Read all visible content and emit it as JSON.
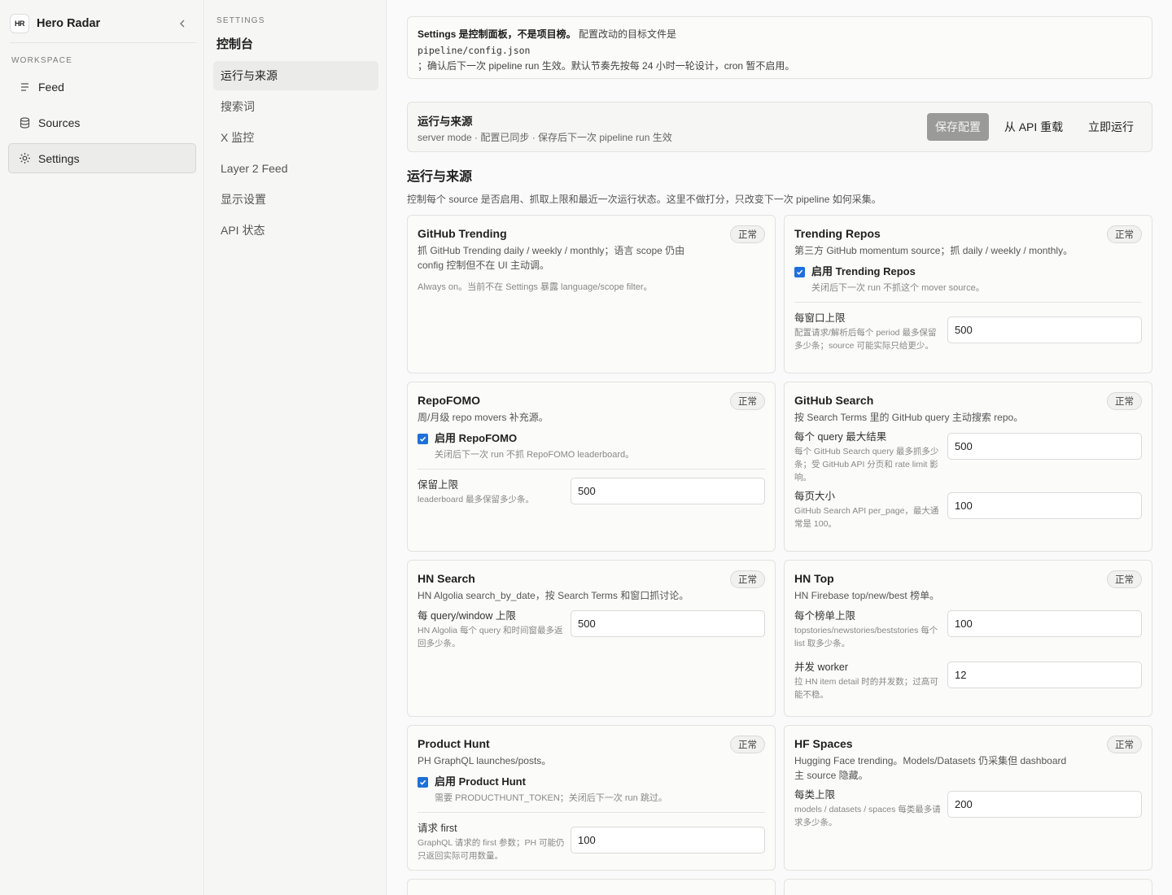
{
  "sidebar": {
    "logo_text": "HR",
    "app_name": "Hero Radar",
    "workspace_label": "WORKSPACE",
    "items": [
      {
        "label": "Feed",
        "icon": "list-icon"
      },
      {
        "label": "Sources",
        "icon": "database-icon"
      },
      {
        "label": "Settings",
        "icon": "gear-icon",
        "active": true
      }
    ]
  },
  "subnav": {
    "kicker": "SETTINGS",
    "title": "控制台",
    "items": [
      {
        "label": "运行与来源",
        "active": true
      },
      {
        "label": "搜索词"
      },
      {
        "label": "X 监控"
      },
      {
        "label": "Layer 2 Feed"
      },
      {
        "label": "显示设置"
      },
      {
        "label": "API 状态"
      }
    ]
  },
  "notice": {
    "bold": "Settings 是控制面板，不是项目榜。",
    "text": "配置改动的目标文件是",
    "path": "pipeline/config.json",
    "line3": "；确认后下一次 pipeline run 生效。默认节奏先按每 24 小时一轮设计，cron 暂不启用。"
  },
  "run_bar": {
    "title": "运行与来源",
    "subtitle": "server mode · 配置已同步 · 保存后下一次 pipeline run 生效",
    "save_label": "保存配置",
    "reload_label": "从 API 重载",
    "run_label": "立即运行"
  },
  "section": {
    "title": "运行与来源",
    "desc": "控制每个 source 是否启用、抓取上限和最近一次运行状态。这里不做打分，只改变下一次 pipeline 如何采集。"
  },
  "cards": [
    {
      "title": "GitHub Trending",
      "status": "正常",
      "desc": "抓 GitHub Trending daily / weekly / monthly；语言 scope 仍由 config 控制但不在 UI 主动调。",
      "note": "Always on。当前不在 Settings 暴露 language/scope filter。"
    },
    {
      "title": "Trending Repos",
      "status": "正常",
      "desc": "第三方 GitHub momentum source；抓 daily / weekly / monthly。",
      "toggle_label": "启用 Trending Repos",
      "toggle_help": "关闭后下一次 run 不抓这个 mover source。",
      "fields": [
        {
          "label": "每窗口上限",
          "help": "配置请求/解析后每个 period 最多保留多少条；source 可能实际只给更少。",
          "value": "500"
        }
      ]
    },
    {
      "title": "RepoFOMO",
      "status": "正常",
      "desc": "周/月级 repo movers 补充源。",
      "toggle_label": "启用 RepoFOMO",
      "toggle_help": "关闭后下一次 run 不抓 RepoFOMO leaderboard。",
      "fields": [
        {
          "label": "保留上限",
          "help": "leaderboard 最多保留多少条。",
          "value": "500"
        }
      ]
    },
    {
      "title": "GitHub Search",
      "status": "正常",
      "desc": "按 Search Terms 里的 GitHub query 主动搜索 repo。",
      "fields": [
        {
          "label": "每个 query 最大结果",
          "help": "每个 GitHub Search query 最多抓多少条；受 GitHub API 分页和 rate limit 影响。",
          "value": "500"
        },
        {
          "label": "每页大小",
          "help": "GitHub Search API per_page，最大通常是 100。",
          "value": "100"
        }
      ]
    },
    {
      "title": "HN Search",
      "status": "正常",
      "desc": "HN Algolia search_by_date，按 Search Terms 和窗口抓讨论。",
      "fields": [
        {
          "label": "每 query/window 上限",
          "help": "HN Algolia 每个 query 和时间窗最多返回多少条。",
          "value": "500"
        }
      ]
    },
    {
      "title": "HN Top",
      "status": "正常",
      "desc": "HN Firebase top/new/best 榜单。",
      "fields": [
        {
          "label": "每个榜单上限",
          "help": "topstories/newstories/beststories 每个 list 取多少条。",
          "value": "100"
        },
        {
          "label": "并发 worker",
          "help": "拉 HN item detail 时的并发数；过高可能不稳。",
          "value": "12"
        }
      ]
    },
    {
      "title": "Product Hunt",
      "status": "正常",
      "desc": "PH GraphQL launches/posts。",
      "toggle_label": "启用 Product Hunt",
      "toggle_help": "需要 PRODUCTHUNT_TOKEN；关闭后下一次 run 跳过。",
      "fields": [
        {
          "label": "请求 first",
          "help": "GraphQL 请求的 first 参数；PH 可能仍只返回实际可用数量。",
          "value": "100"
        }
      ]
    },
    {
      "title": "HF Spaces",
      "status": "正常",
      "desc": "Hugging Face trending。Models/Datasets 仍采集但 dashboard 主 source 隐藏。",
      "fields": [
        {
          "label": "每类上限",
          "help": "models / datasets / spaces 每类最多请求多少条。",
          "value": "200"
        }
      ]
    }
  ],
  "colors": {
    "accent": "#1e6fd9",
    "save_button": "#9a9a98"
  }
}
